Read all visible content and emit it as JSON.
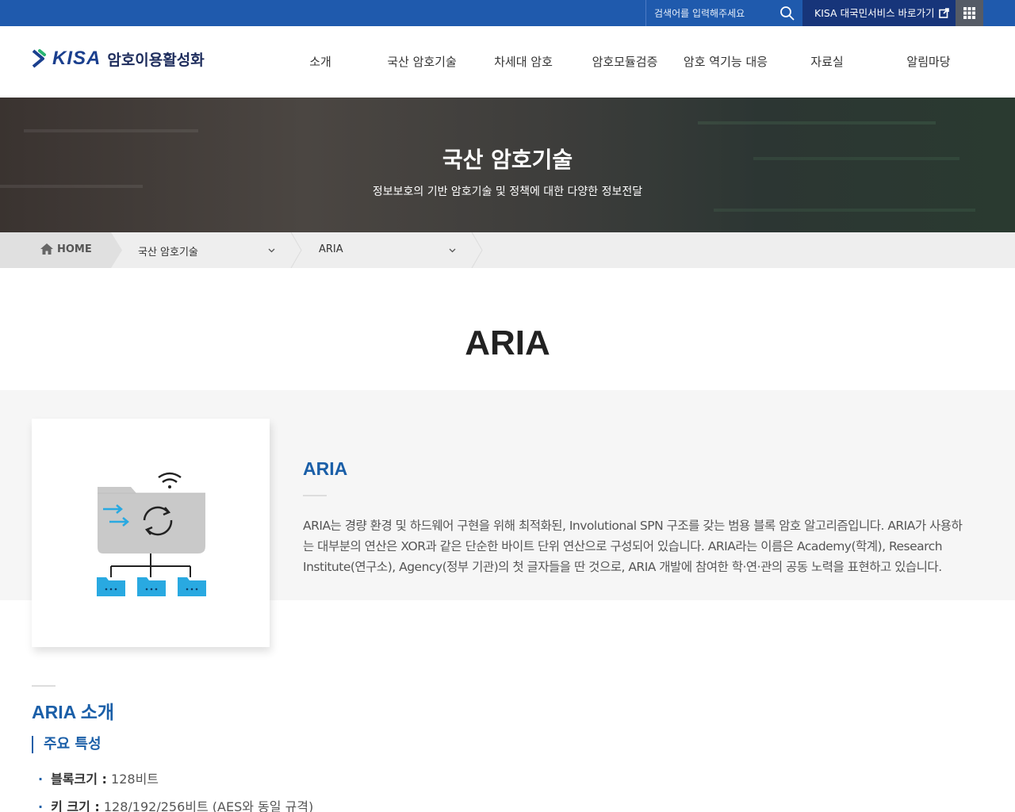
{
  "topbar": {
    "search_placeholder": "검색어를 입력해주세요",
    "kisa_link_label": "KISA 대국민서비스 바로가기"
  },
  "header": {
    "logo_kisa": "KISA",
    "logo_text": "암호이용활성화",
    "nav": [
      "소개",
      "국산 암호기술",
      "차세대 암호",
      "암호모듈검증",
      "암호 역기능 대응",
      "자료실",
      "알림마당"
    ]
  },
  "banner": {
    "title": "국산 암호기술",
    "subtitle": "정보보호의 기반 암호기술 및 정책에 대한 다양한 정보전달"
  },
  "breadcrumb": {
    "home": "HOME",
    "level1": "국산 암호기술",
    "level2": "ARIA"
  },
  "page": {
    "title": "ARIA"
  },
  "intro": {
    "heading": "ARIA",
    "text": "ARIA는 경량 환경 및 하드웨어 구현을 위해 최적화된, Involutional SPN 구조를 갖는 범용 블록 암호 알고리즘입니다. ARIA가 사용하는 대부분의 연산은 XOR과 같은 단순한 바이트 단위 연산으로 구성되어 있습니다. ARIA라는 이름은 Academy(학계), Research Institute(연구소), Agency(정부 기관)의 첫 글자들을 딴 것으로, ARIA 개발에 참여한 학·연·관의 공동 노력을 표현하고 있습니다."
  },
  "section": {
    "title": "ARIA 소개",
    "subtitle": "주요 특성",
    "features": [
      {
        "label": "블록크기 :",
        "value": " 128비트"
      },
      {
        "label": "키 크기 :",
        "value": " 128/192/256비트 (AES와 동일 규격)"
      }
    ]
  },
  "colors": {
    "topbar": "#1f5aad",
    "kisa_link_bg": "#17357a",
    "accent": "#1b5fa8"
  }
}
